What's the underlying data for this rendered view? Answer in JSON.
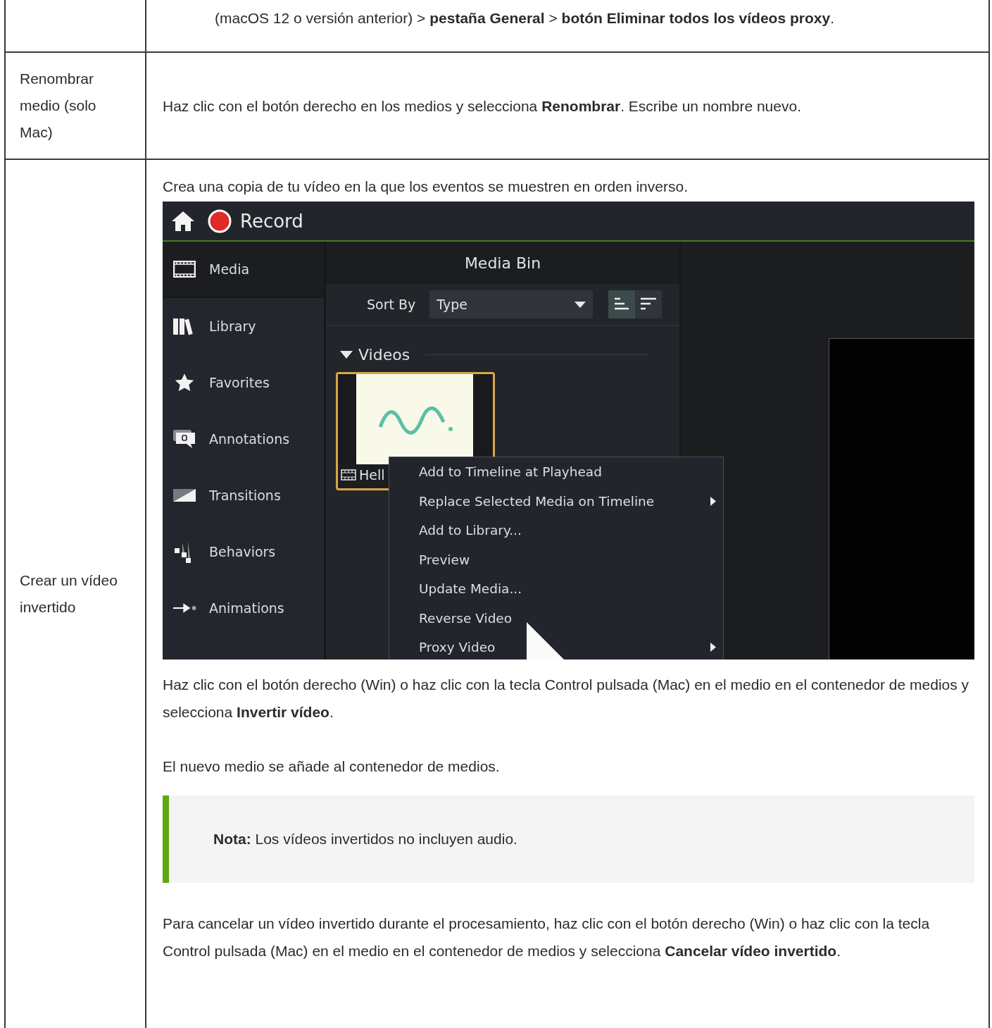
{
  "table": {
    "rows": [
      {
        "label": "",
        "blocks": [
          {
            "kind": "continuation",
            "text": "(macOS 12 o versión anterior) > **pestaña General** > **botón Eliminar todos los vídeos proxy**."
          }
        ]
      },
      {
        "label": "Renombrar medio (solo Mac)",
        "blocks": [
          {
            "kind": "paragraph",
            "text": "Haz clic con el botón derecho en los medios y selecciona **Renombrar**. Escribe un nombre nuevo."
          }
        ]
      },
      {
        "label": "Crear un vídeo invertido",
        "blocks": [
          {
            "kind": "paragraph",
            "text": "Crea una copia de tu vídeo en la que los eventos se muestren en orden inverso."
          },
          {
            "kind": "screenshot",
            "app": {
              "record_label": "Record",
              "sidebar": [
                {
                  "label": "Media",
                  "selected": true
                },
                {
                  "label": "Library",
                  "selected": false
                },
                {
                  "label": "Favorites",
                  "selected": false
                },
                {
                  "label": "Annotations",
                  "selected": false
                },
                {
                  "label": "Transitions",
                  "selected": false
                },
                {
                  "label": "Behaviors",
                  "selected": false
                },
                {
                  "label": "Animations",
                  "selected": false
                }
              ],
              "media_bin": {
                "title": "Media Bin",
                "sort_label": "Sort By",
                "sort_value": "Type",
                "section": "Videos",
                "clip_label": "Hell"
              },
              "context_menu": [
                {
                  "label": "Add to Timeline at Playhead",
                  "submenu": false
                },
                {
                  "label": "Replace Selected Media on Timeline",
                  "submenu": true
                },
                {
                  "label": "Add to Library...",
                  "submenu": false
                },
                {
                  "label": "Preview",
                  "submenu": false
                },
                {
                  "label": "Update Media...",
                  "submenu": false
                },
                {
                  "label": "Reverse Video",
                  "submenu": false
                },
                {
                  "label": "Proxy Video",
                  "submenu": true
                }
              ]
            }
          },
          {
            "kind": "paragraph",
            "text": "Haz clic con el botón derecho (Win) o haz clic con la tecla Control pulsada (Mac) en el medio en el contenedor de medios y selecciona **Invertir vídeo**."
          },
          {
            "kind": "paragraph",
            "text": "El nuevo medio se añade al contenedor de medios."
          },
          {
            "kind": "note",
            "text": "**Nota:** Los vídeos invertidos no incluyen audio."
          },
          {
            "kind": "paragraph",
            "text": "Para cancelar un vídeo invertido durante el procesamiento, haz clic con el botón derecho (Win) o haz clic con la tecla Control pulsada (Mac) en el medio en el contenedor de medios y selecciona **Cancelar vídeo invertido**."
          }
        ]
      }
    ]
  }
}
